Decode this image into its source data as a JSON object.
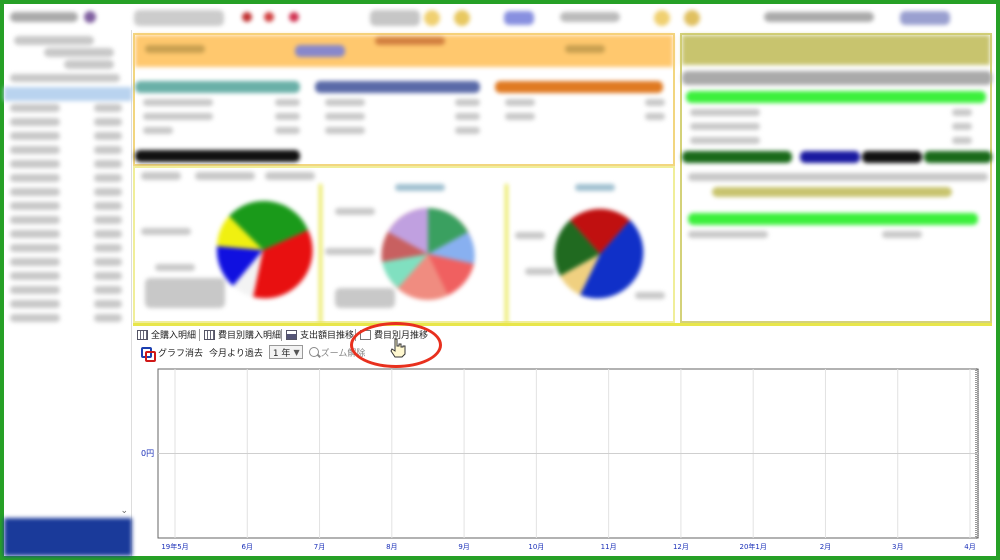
{
  "tabs": [
    {
      "label": "全購入明細",
      "icon": "calendar-grid-icon"
    },
    {
      "label": "費目別購入明細",
      "icon": "calendar-grid-icon"
    },
    {
      "label": "支出額目推移",
      "icon": "bar-chart-icon"
    },
    {
      "label": "費目別月推移",
      "icon": "line-chart-icon",
      "active": true
    }
  ],
  "graph_toolbar": {
    "clear_label": "グラフ消去",
    "period_label": "今月より過去",
    "period_value": "1 年",
    "zoom_label": "ズーム解除"
  },
  "colors": {
    "frame": "#26a026",
    "highlight": "#e8301e",
    "axis_text": "#1a2fb8"
  },
  "chart_data": {
    "type": "line",
    "x": [
      "19年5月",
      "6月",
      "7月",
      "8月",
      "9月",
      "10月",
      "11月",
      "12月",
      "20年1月",
      "2月",
      "3月",
      "4月"
    ],
    "y_ticks": [
      "0円"
    ],
    "series": [],
    "grid": true
  }
}
